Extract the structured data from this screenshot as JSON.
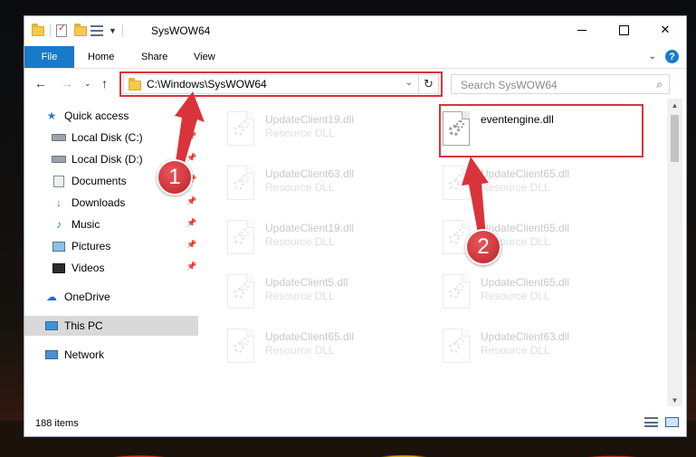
{
  "window": {
    "title": "SysWOW64"
  },
  "ribbon": {
    "tabs": [
      "File",
      "Home",
      "Share",
      "View"
    ]
  },
  "address": {
    "path": "C:\\Windows\\SysWOW64",
    "search_placeholder": "Search SysWOW64"
  },
  "nav": {
    "items": [
      {
        "label": "Quick access",
        "icon": "star-icon",
        "pinned": false
      },
      {
        "label": "Local Disk (C:)",
        "icon": "drive-icon",
        "pinned": true
      },
      {
        "label": "Local Disk (D:)",
        "icon": "drive-icon",
        "pinned": true
      },
      {
        "label": "Documents",
        "icon": "documents-icon",
        "pinned": true
      },
      {
        "label": "Downloads",
        "icon": "downloads-icon",
        "pinned": true
      },
      {
        "label": "Music",
        "icon": "music-icon",
        "pinned": true
      },
      {
        "label": "Pictures",
        "icon": "pictures-icon",
        "pinned": true
      },
      {
        "label": "Videos",
        "icon": "videos-icon",
        "pinned": true
      },
      {
        "label": "OneDrive",
        "icon": "onedrive-icon",
        "pinned": false
      },
      {
        "label": "This PC",
        "icon": "this-pc-icon",
        "pinned": false,
        "selected": true
      },
      {
        "label": "Network",
        "icon": "network-icon",
        "pinned": false
      }
    ]
  },
  "files": [
    {
      "name": "UpdateClient19.dll",
      "type": "Resource DLL",
      "ghost": true
    },
    {
      "name": "eventengine.dll",
      "type": "",
      "ghost": false,
      "highlighted": true
    },
    {
      "name": "UpdateClient63.dll",
      "type": "Resource DLL",
      "ghost": true
    },
    {
      "name": "UpdateClient65.dll",
      "type": "Resource DLL",
      "ghost": true
    },
    {
      "name": "UpdateClient19.dll",
      "type": "Resource DLL",
      "ghost": true
    },
    {
      "name": "UpdateClient65.dll",
      "type": "Resource DLL",
      "ghost": true
    },
    {
      "name": "UpdateClient5.dll",
      "type": "Resource DLL",
      "ghost": true
    },
    {
      "name": "UpdateClient65.dll",
      "type": "Resource DLL",
      "ghost": true
    },
    {
      "name": "UpdateClient65.dll",
      "type": "Resource DLL",
      "ghost": true
    },
    {
      "name": "UpdateClient63.dll",
      "type": "Resource DLL",
      "ghost": true
    }
  ],
  "status": {
    "item_count": "188 items"
  },
  "annotations": {
    "step1": "1",
    "step2": "2",
    "color": "#d9343a"
  }
}
